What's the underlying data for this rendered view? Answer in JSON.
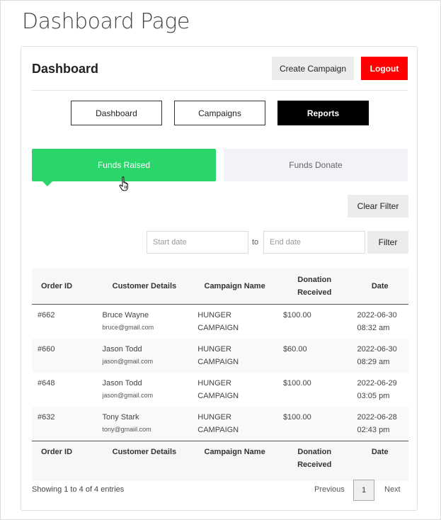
{
  "page": {
    "title": "Dashboard Page"
  },
  "card": {
    "title": "Dashboard"
  },
  "header_buttons": {
    "create_campaign": "Create Campaign",
    "logout": "Logout"
  },
  "nav_tabs": [
    "Dashboard",
    "Campaigns",
    "Reports"
  ],
  "active_nav_tab": "Reports",
  "report_tabs": [
    "Funds Raised",
    "Funds Donate"
  ],
  "active_report_tab": "Funds Raised",
  "filters": {
    "clear_label": "Clear Filter",
    "start_placeholder": "Start date",
    "to_label": "to",
    "end_placeholder": "End date",
    "filter_label": "Filter"
  },
  "table": {
    "columns": [
      "Order ID",
      "Customer Details",
      "Campaign Name",
      "Donation Received",
      "Date"
    ],
    "rows": [
      {
        "order_id": "#662",
        "name": "Bruce Wayne",
        "email": "bruce@gmail.com",
        "campaign": "HUNGER CAMPAIGN",
        "amount": "$100.00",
        "date": "2022-06-30",
        "time": "08:32 am"
      },
      {
        "order_id": "#660",
        "name": "Jason Todd",
        "email": "jason@gmail.com",
        "campaign": "HUNGER CAMPAIGN",
        "amount": "$60.00",
        "date": "2022-06-30",
        "time": "08:29 am"
      },
      {
        "order_id": "#648",
        "name": "Jason Todd",
        "email": "jason@gmail.com",
        "campaign": "HUNGER CAMPAIGN",
        "amount": "$100.00",
        "date": "2022-06-29",
        "time": "03:05 pm"
      },
      {
        "order_id": "#632",
        "name": "Tony Stark",
        "email": "tony@gmaiil.com",
        "campaign": "HUNGER CAMPAIGN",
        "amount": "$100.00",
        "date": "2022-06-28",
        "time": "02:43 pm"
      }
    ]
  },
  "pagination": {
    "info": "Showing 1 to 4 of 4 entries",
    "previous": "Previous",
    "current_page": "1",
    "next": "Next"
  },
  "colors": {
    "accent_green": "#2ad66a",
    "logout_red": "#ff0000",
    "active_tab_black": "#000000"
  },
  "icons": {
    "cursor": "hand-pointer-icon"
  }
}
